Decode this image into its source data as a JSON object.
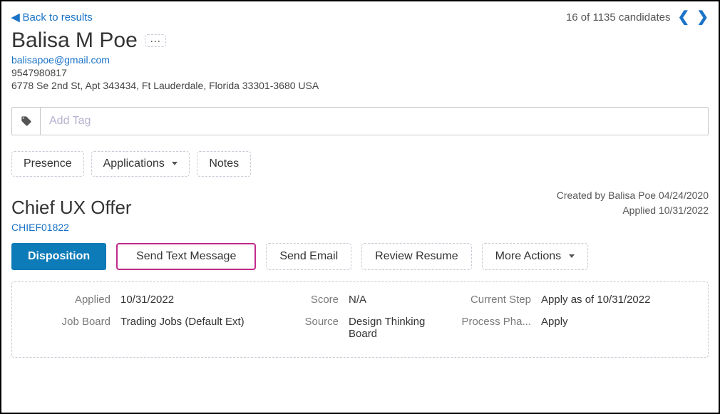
{
  "nav": {
    "back_label": "Back to results",
    "count_text": "16 of 1135 candidates"
  },
  "candidate": {
    "name": "Balisa M Poe",
    "email": "balisapoe@gmail.com",
    "phone": "9547980817",
    "address": "6778 Se 2nd St, Apt 343434, Ft Lauderdale, Florida 33301-3680 USA"
  },
  "tag": {
    "placeholder": "Add Tag"
  },
  "tabs": {
    "presence": "Presence",
    "applications": "Applications",
    "notes": "Notes"
  },
  "meta": {
    "created": "Created by Balisa Poe 04/24/2020",
    "applied": "Applied 10/31/2022"
  },
  "job": {
    "title": "Chief UX Offer",
    "id": "CHIEF01822"
  },
  "actions": {
    "disposition": "Disposition",
    "send_text": "Send Text Message",
    "send_email": "Send Email",
    "review_resume": "Review Resume",
    "more_actions": "More Actions"
  },
  "details": {
    "applied_label": "Applied",
    "applied_value": "10/31/2022",
    "score_label": "Score",
    "score_value": "N/A",
    "current_step_label": "Current Step",
    "current_step_value": "Apply as of 10/31/2022",
    "job_board_label": "Job Board",
    "job_board_value": "Trading Jobs (Default Ext)",
    "source_label": "Source",
    "source_value": "Design Thinking Board",
    "process_phase_label": "Process Pha...",
    "process_phase_value": "Apply"
  }
}
